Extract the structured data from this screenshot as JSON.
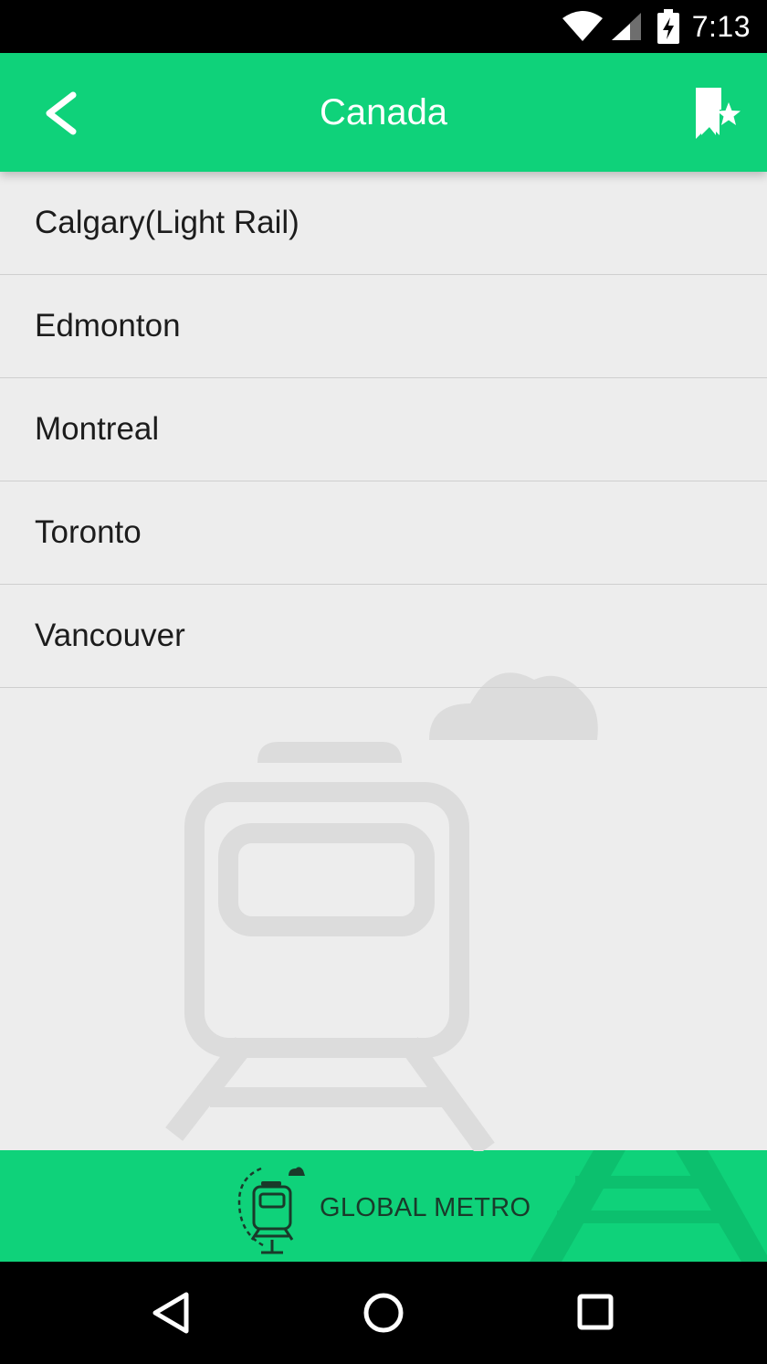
{
  "status_bar": {
    "time": "7:13"
  },
  "app_bar": {
    "title": "Canada"
  },
  "cities": [
    {
      "name": "Calgary(Light Rail)"
    },
    {
      "name": "Edmonton"
    },
    {
      "name": "Montreal"
    },
    {
      "name": "Toronto"
    },
    {
      "name": "Vancouver"
    }
  ],
  "footer": {
    "brand": "GLOBAL METRO"
  },
  "colors": {
    "accent": "#0fd27a",
    "background": "#ededed",
    "watermark": "#dcdcdc"
  },
  "icons": {
    "back": "back-arrow-icon",
    "favorites": "bookmark-star-icon",
    "watermark": "train-icon",
    "brand": "metro-logo-icon"
  }
}
